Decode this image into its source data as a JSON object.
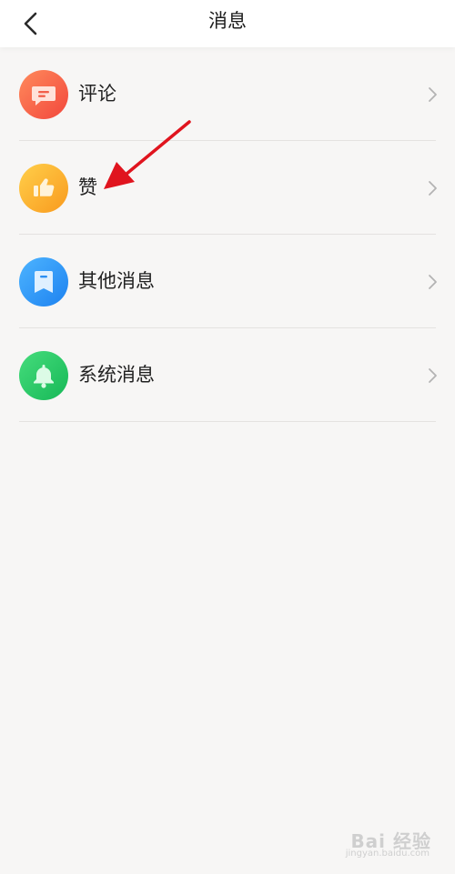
{
  "header": {
    "title": "消息",
    "back_icon": "chevron-left-icon"
  },
  "menu": {
    "items": [
      {
        "label": "评论",
        "icon": "comment-icon",
        "color_from": "#ff8a5c",
        "color_to": "#f2473c"
      },
      {
        "label": "赞",
        "icon": "thumbs-up-icon",
        "color_from": "#ffcf4a",
        "color_to": "#f99a1e"
      },
      {
        "label": "其他消息",
        "icon": "bookmark-icon",
        "color_from": "#4db4ff",
        "color_to": "#1d82f0"
      },
      {
        "label": "系统消息",
        "icon": "bell-icon",
        "color_from": "#45dc7c",
        "color_to": "#17b857"
      }
    ]
  },
  "annotation": {
    "arrow_color": "#e0141e"
  },
  "watermark": {
    "main": "Bai 经验",
    "sub": "jingyan.baidu.com"
  }
}
